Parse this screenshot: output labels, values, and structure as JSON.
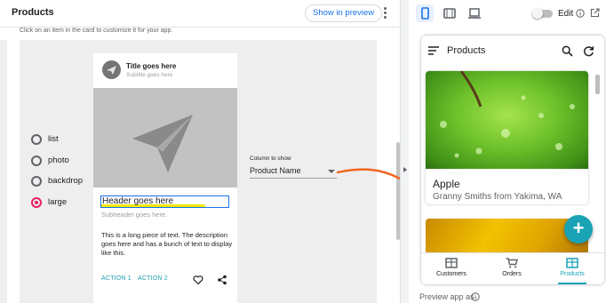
{
  "editor": {
    "title": "Products",
    "show_preview_label": "Show in preview",
    "instructions": "Click on an item in the card to customize it for your app.",
    "view_options": [
      {
        "label": "list",
        "selected": false
      },
      {
        "label": "photo",
        "selected": false
      },
      {
        "label": "backdrop",
        "selected": false
      },
      {
        "label": "large",
        "selected": true
      }
    ],
    "card": {
      "title": "Title goes here",
      "subtitle": "Subtitle goes here",
      "header": "Header goes here",
      "subheader": "Subheader goes here.",
      "body": "This is a long piece of text. The description goes here and has a bunch of text to display like this.",
      "action1": "ACTION 1",
      "action2": "ACTION 2"
    },
    "column_to_show": {
      "label": "Column to show",
      "value": "Product Name"
    }
  },
  "preview": {
    "edit_label": "Edit",
    "edit_toggle_on": false,
    "app_title": "Products",
    "item": {
      "name": "Apple",
      "subtitle": "Granny Smiths from Yakima, WA"
    },
    "fab_label": "+",
    "nav": [
      {
        "label": "Customers",
        "icon": "table-icon",
        "active": false
      },
      {
        "label": "Orders",
        "icon": "cart-icon",
        "active": false
      },
      {
        "label": "Products",
        "icon": "table-icon",
        "active": true
      }
    ],
    "preview_as_label": "Preview app as"
  },
  "colors": {
    "accent": "#1a73e8",
    "teal": "#1aa3b5",
    "radio_selected": "#e91e63",
    "arrow": "#f26522",
    "highlight": "#f5e800"
  }
}
